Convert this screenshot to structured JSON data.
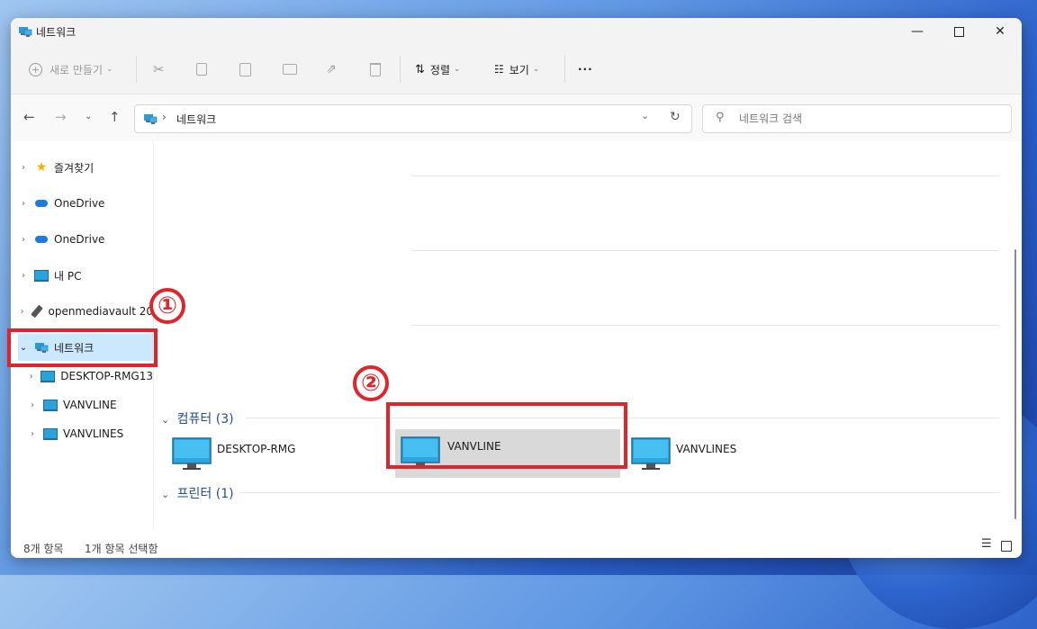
{
  "window": {
    "title": "네트워크"
  },
  "toolbar": {
    "new_label": "새로 만들기",
    "sort_label": "정렬",
    "view_label": "보기",
    "more_label": "···"
  },
  "address": {
    "crumb": "네트워크",
    "search_placeholder": "네트워크 검색"
  },
  "sidebar": {
    "items": [
      {
        "label": "즐겨찾기",
        "icon": "star-icon"
      },
      {
        "label": "OneDrive",
        "icon": "cloud-icon"
      },
      {
        "label": "OneDrive",
        "icon": "cloud-icon"
      },
      {
        "label": "내 PC",
        "icon": "monitor-icon"
      },
      {
        "label": "openmediavault 20",
        "icon": "usb-drive-icon"
      },
      {
        "label": "네트워크",
        "icon": "network-icon",
        "selected": true
      },
      {
        "label": "DESKTOP-RMG13",
        "icon": "monitor-icon"
      },
      {
        "label": "VANVLINE",
        "icon": "monitor-icon"
      },
      {
        "label": "VANVLINES",
        "icon": "monitor-icon"
      }
    ]
  },
  "content": {
    "groups": [
      {
        "label": "컴퓨터 (3)"
      },
      {
        "label": "프린터 (1)"
      }
    ],
    "computers": [
      {
        "name": "DESKTOP-RMG"
      },
      {
        "name": "VANVLINE",
        "selected": true
      },
      {
        "name": "VANVLINES"
      }
    ]
  },
  "status": {
    "item_count": "8개 항목",
    "selected_count": "1개 항목 선택함"
  },
  "annotations": {
    "one": "①",
    "two": "②",
    "color": "#e1232b"
  },
  "colors": {
    "selection": "#cce8ff",
    "tile_selected": "#d9d9d9",
    "accent": "#0067c0"
  }
}
